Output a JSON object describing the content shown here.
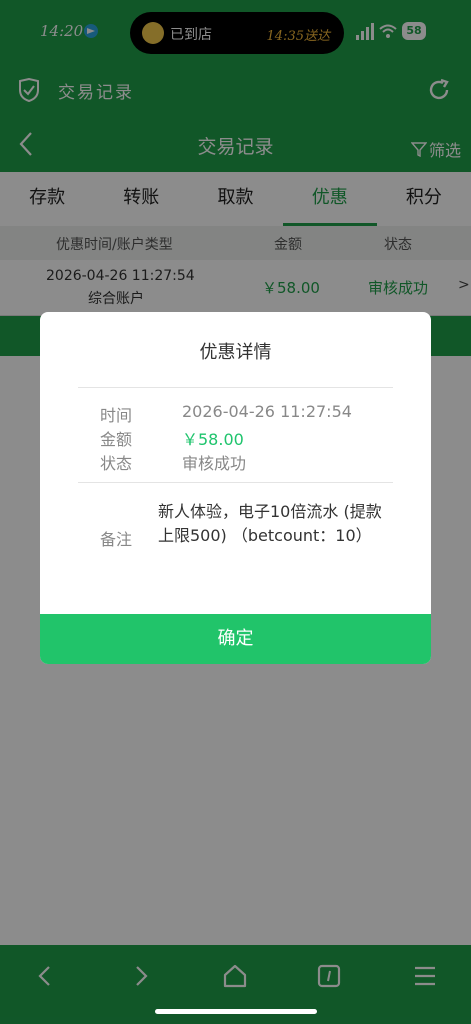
{
  "status_bar": {
    "time": "14:20",
    "island_text": "已到店",
    "island_time": "14:35送达",
    "battery": "58"
  },
  "app_bar": {
    "title": "交易记录"
  },
  "page_header": {
    "title": "交易记录",
    "filter_label": "筛选"
  },
  "tabs": [
    {
      "label": "存款"
    },
    {
      "label": "转账"
    },
    {
      "label": "取款"
    },
    {
      "label": "优惠"
    },
    {
      "label": "积分"
    }
  ],
  "table": {
    "headers": {
      "time_type": "优惠时间/账户类型",
      "amount": "金额",
      "status": "状态"
    },
    "rows": [
      {
        "date": "2026-04-26 11:27:54",
        "account_type": "综合账户",
        "amount": "￥58.00",
        "status": "审核成功",
        "arrow": ">"
      }
    ]
  },
  "modal": {
    "title": "优惠详情",
    "time_label": "时间",
    "time_value": "2026-04-26 11:27:54",
    "amount_label": "金额",
    "amount_value": "￥58.00",
    "status_label": "状态",
    "status_value": "审核成功",
    "note_label": "备注",
    "note_value": "新人体验，电子10倍流水 (提款上限500) （betcount：10）",
    "confirm_label": "确定"
  },
  "colors": {
    "brand": "#1f9e4a",
    "confirm": "#21c46a",
    "amount_green": "#1fc46d"
  },
  "icons": [
    "telegram-icon",
    "shield-icon",
    "refresh-icon",
    "back-icon",
    "filter-icon",
    "nav-back-icon",
    "nav-forward-icon",
    "home-icon",
    "tabs-icon",
    "menu-icon"
  ]
}
